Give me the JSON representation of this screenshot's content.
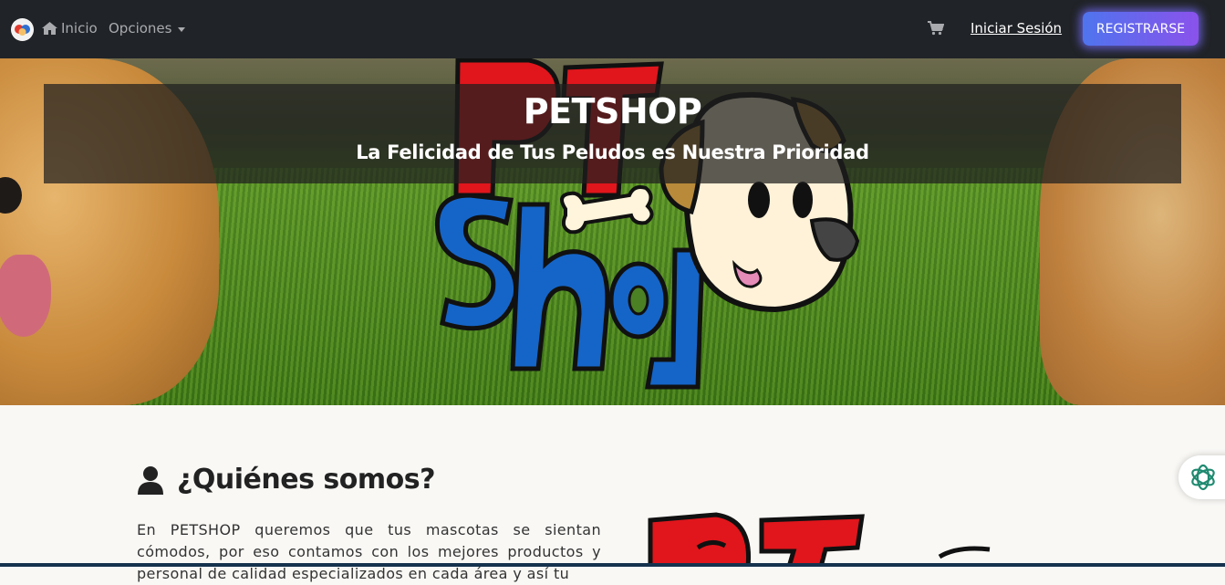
{
  "navbar": {
    "home_label": "Inicio",
    "options_label": "Opciones",
    "login_label": "Iniciar Sesión",
    "register_label": "REGISTRARSE",
    "icons": [
      "brand-logo",
      "home-icon",
      "chevron-down-icon",
      "cart-icon"
    ]
  },
  "hero": {
    "title": "PETSHOP",
    "subtitle": "La Felicidad de Tus Peludos es Nuestra Prioridad"
  },
  "about": {
    "heading": "¿Quiénes somos?",
    "text": "En PETSHOP queremos que tus mascotas se sientan cómodos, por eso contamos con los mejores productos y personal de calidad especializados en cada área y así tu"
  },
  "colors": {
    "navbar_bg": "#202327",
    "register_gradient_start": "#4f74ee",
    "register_gradient_end": "#8a52ec",
    "chat_icon": "#1f8a70"
  }
}
